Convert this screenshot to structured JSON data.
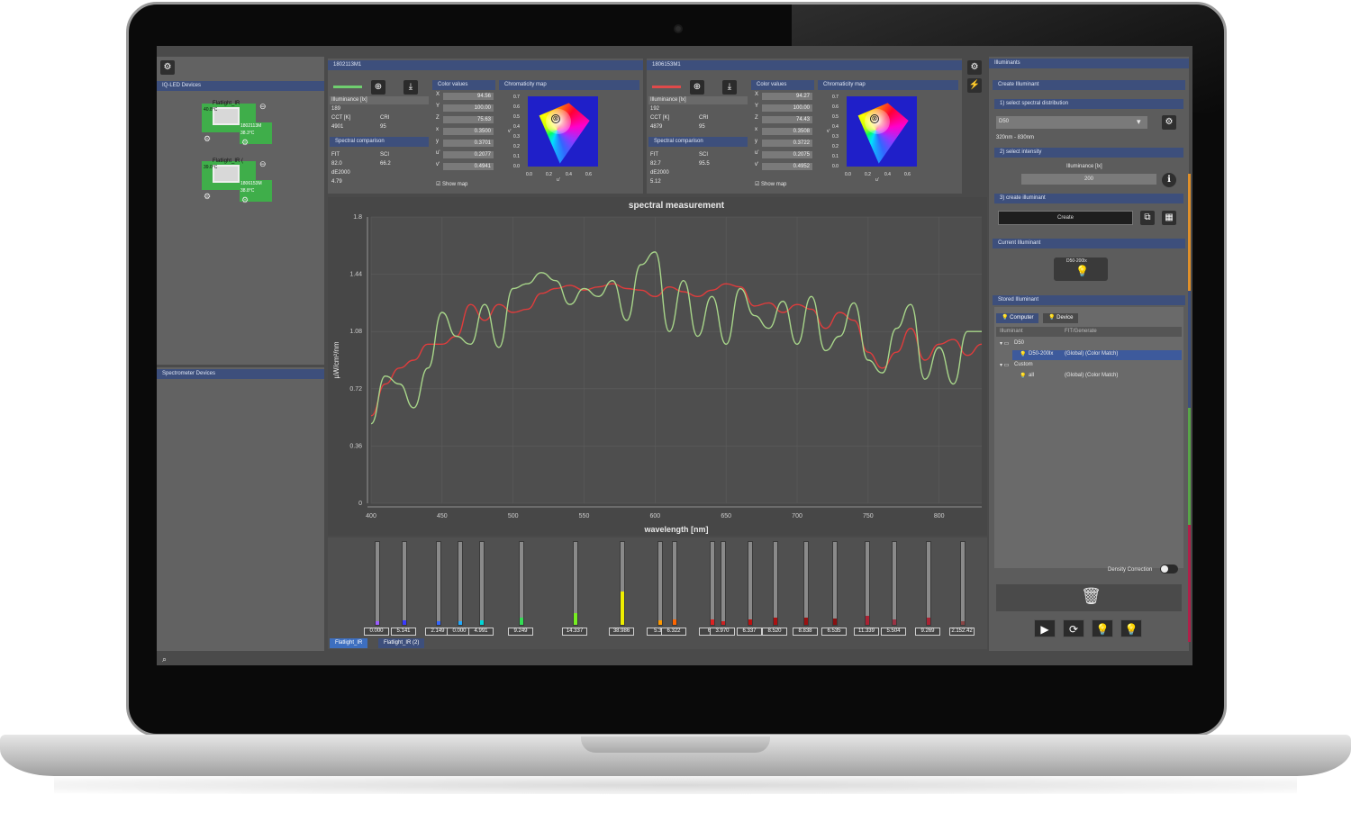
{
  "left_panel": {
    "iq_led_header": "IQ-LED Devices",
    "spectrometer_header": "Spectrometer Devices",
    "devices": [
      {
        "name": "Flatlight_IR",
        "serial": "1802113M",
        "temp": "38.3°C",
        "temp2": "40.8°C"
      },
      {
        "name": "Flatlight_IR (",
        "serial": "1806153M",
        "temp": "38.8°C",
        "temp2": "39.0°C"
      }
    ]
  },
  "device1": {
    "title": "1802113M1",
    "illuminance_label": "Illuminance [lx]",
    "illuminance": "189",
    "cct_label": "CCT [K]",
    "cri_label": "CRI",
    "cct": "4901",
    "cri": "95",
    "spectral_header": "Spectral comparison",
    "fit_label": "FIT",
    "sci_label": "SCI",
    "fit": "82.0",
    "sci": "66.2",
    "de_label": "dE2000",
    "de": "4.79",
    "color_header": "Color values",
    "color_keys": [
      "X",
      "Y",
      "Z",
      "x",
      "y",
      "u'",
      "v'"
    ],
    "color_values": [
      "94.56",
      "100.00",
      "75.63",
      "0.3500",
      "0.3701",
      "0.2077",
      "0.4941"
    ],
    "show_map": "Show map",
    "chroma_header": "Chromaticity map"
  },
  "device2": {
    "title": "1806153M1",
    "illuminance_label": "Illuminance [lx]",
    "illuminance": "192",
    "cct_label": "CCT [K]",
    "cri_label": "CRI",
    "cct": "4879",
    "cri": "95",
    "spectral_header": "Spectral comparison",
    "fit_label": "FIT",
    "sci_label": "SCI",
    "fit": "82.7",
    "sci": "95.5",
    "de_label": "dE2000",
    "de": "5.12",
    "color_header": "Color values",
    "color_keys": [
      "X",
      "Y",
      "Z",
      "x",
      "y",
      "u'",
      "v'"
    ],
    "color_values": [
      "94.27",
      "100.00",
      "74.43",
      "0.3508",
      "0.3722",
      "0.2075",
      "0.4952"
    ],
    "show_map": "Show map",
    "chroma_header": "Chromaticity map"
  },
  "chroma_axis": {
    "y_ticks": [
      "0.7",
      "0.6",
      "0.5",
      "0.4",
      "0.3",
      "0.2",
      "0.1",
      "0.0"
    ],
    "x_ticks": [
      "0.0",
      "0.2",
      "0.4",
      "0.6"
    ],
    "x_label": "u'",
    "y_label": "v'"
  },
  "chart_data": {
    "type": "line",
    "title": "spectral measurement",
    "xlabel": "wavelength [nm]",
    "ylabel": "µW/cm²/nm",
    "xlim": [
      400,
      830
    ],
    "ylim": [
      0,
      1.8
    ],
    "x_ticks": [
      400,
      450,
      500,
      550,
      600,
      650,
      700,
      750,
      800
    ],
    "y_ticks": [
      0,
      0.36,
      0.72,
      1.08,
      1.44,
      1.8
    ],
    "y_tick_labels": [
      "0",
      "0.36",
      "0.72",
      "1.08",
      "1.44",
      "1.8"
    ],
    "grid": true,
    "colors": {
      "red": "#e03c3c",
      "green": "#a8d68a"
    },
    "series": [
      {
        "x": [
          400,
          410,
          420,
          430,
          440,
          450,
          460,
          470,
          480,
          490,
          500,
          510,
          520,
          530,
          540,
          550,
          560,
          570,
          580,
          590,
          600,
          610,
          620,
          630,
          640,
          650,
          660,
          670,
          680,
          690,
          700,
          710,
          720,
          730,
          740,
          750,
          760,
          770,
          780,
          790,
          800,
          810,
          820,
          830
        ],
        "values": [
          0.55,
          0.75,
          0.85,
          0.9,
          1.0,
          1.0,
          1.05,
          1.25,
          1.15,
          1.25,
          1.2,
          1.22,
          1.32,
          1.35,
          1.37,
          1.34,
          1.36,
          1.38,
          1.35,
          1.34,
          1.3,
          1.36,
          1.33,
          1.3,
          1.34,
          1.38,
          1.36,
          1.24,
          1.26,
          1.2,
          1.25,
          1.22,
          1.1,
          1.2,
          1.15,
          0.95,
          0.85,
          0.95,
          1.1,
          0.9,
          1.0,
          1.03,
          0.93,
          1.0
        ]
      },
      {
        "x": [
          400,
          410,
          420,
          430,
          440,
          450,
          460,
          470,
          480,
          490,
          500,
          510,
          520,
          530,
          540,
          550,
          560,
          570,
          580,
          590,
          600,
          610,
          620,
          630,
          640,
          650,
          660,
          670,
          680,
          690,
          700,
          710,
          720,
          730,
          740,
          750,
          760,
          770,
          780,
          790,
          800,
          810,
          820,
          830
        ],
        "values": [
          0.5,
          0.8,
          0.75,
          0.6,
          0.85,
          1.2,
          1.05,
          1.0,
          1.25,
          0.98,
          1.35,
          1.38,
          1.45,
          1.4,
          1.25,
          1.35,
          1.3,
          1.4,
          1.15,
          1.5,
          1.58,
          1.08,
          1.4,
          1.05,
          1.3,
          1.0,
          1.35,
          1.18,
          1.1,
          1.27,
          1.0,
          1.3,
          0.96,
          1.05,
          1.26,
          0.9,
          0.82,
          1.1,
          1.25,
          0.78,
          0.98,
          0.75,
          1.08,
          1.08
        ]
      }
    ]
  },
  "channels": {
    "values": [
      "0.000",
      "5.141",
      "2.149",
      "0.000",
      "4.991",
      "9.249",
      "14.337",
      "38.986",
      "5.32",
      "6.322",
      "6.4",
      "3.970",
      "6.337",
      "8.520",
      "8.838",
      "6.535",
      "11.339",
      "5.504",
      "9.269",
      "2.152.42"
    ],
    "levels": [
      0.0,
      0.05,
      0.02,
      0.0,
      0.05,
      0.09,
      0.14,
      0.39,
      0.05,
      0.06,
      0.06,
      0.04,
      0.06,
      0.09,
      0.09,
      0.07,
      0.11,
      0.06,
      0.09,
      0.02
    ],
    "colors": [
      "#9b5cff",
      "#3a3aff",
      "#3366ff",
      "#22aaff",
      "#00d6d6",
      "#33dd55",
      "#77ee22",
      "#eeee00",
      "#ff9900",
      "#ff6600",
      "#dd2222",
      "#cc2222",
      "#bb1111",
      "#aa1111",
      "#991111",
      "#881111",
      "#aa2233",
      "#993344",
      "#aa2233",
      "#884444"
    ],
    "tabs": [
      "Flatlight_IR",
      "Flatlight_IR (2)"
    ]
  },
  "right_panel": {
    "illuminants_header": "Illuminants",
    "create_header": "Create Illuminant",
    "step1": "1) select spectral distribution",
    "distribution": "D50",
    "range": "320nm - 830nm",
    "step2": "2) select intensity",
    "illuminance_label": "Illuminance [lx]",
    "illuminance_value": "200",
    "step3": "3) create illuminant",
    "create_btn": "Create",
    "current_header": "Current Illuminant",
    "current_value": "D50-200lx",
    "stored_header": "Stored Illuminant",
    "tab_computer": "Computer",
    "tab_device": "Device",
    "col_illuminant": "Illuminant",
    "col_fit": "FIT/Generate",
    "tree": [
      {
        "label": "D50",
        "level": 0
      },
      {
        "label": "D50-200lx",
        "extra": "(Global) (Color Match)",
        "level": 1,
        "selected": true
      },
      {
        "label": "Custom",
        "level": 0
      },
      {
        "label": "all",
        "extra": "(Global) (Color Match)",
        "level": 1,
        "selected": false
      }
    ],
    "density_label": "Density Correction"
  }
}
